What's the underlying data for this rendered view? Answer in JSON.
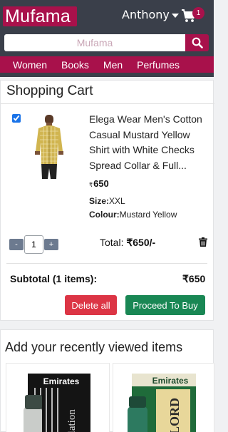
{
  "header": {
    "logo_text": "Mufama",
    "user_name": "Anthony",
    "cart_count": "1",
    "search_placeholder": "Mufama",
    "colors": {
      "bar": "#3a3f4a",
      "brand": "#a8114b"
    }
  },
  "categories": [
    {
      "label": "Women"
    },
    {
      "label": "Books"
    },
    {
      "label": "Men"
    },
    {
      "label": "Perfumes"
    }
  ],
  "cart": {
    "title": "Shopping Cart",
    "item": {
      "checked": true,
      "name": "Elega Wear Men's Cotton Casual Mustard Yellow Shirt with White Checks Spread Collar & Full...",
      "currency_symbol": "₹",
      "price": "650",
      "size_label": "Size:",
      "size_value": "XXL",
      "colour_label": "Colour:",
      "colour_value": "Mustard Yellow",
      "qty_minus": "-",
      "qty_value": "1",
      "qty_plus": "+",
      "total_label": "Total:",
      "total_value": "₹650/-",
      "image_icon": "shirt-product-image"
    },
    "subtotal_label": "Subtotal (1 items):",
    "subtotal_value": "₹650",
    "delete_all_label": "Delete all",
    "proceed_label": "Proceed To Buy"
  },
  "recent": {
    "title": "Add your recently viewed items",
    "items": [
      {
        "brand_text": "Emirates",
        "side_text": "relation"
      },
      {
        "brand_text": "Emirates",
        "side_text": "LORD"
      }
    ]
  }
}
